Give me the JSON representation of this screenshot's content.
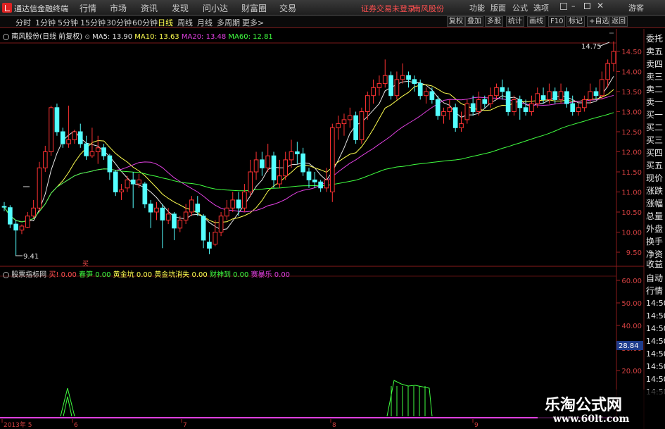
{
  "app": {
    "title": "通达信金融终端",
    "menus": [
      "行情",
      "市场",
      "资讯",
      "发现",
      "问小达",
      "财富圈",
      "交易"
    ],
    "status_notice": "证券交易未登录",
    "status_stock": "南风股份",
    "right_menus": [
      "功能",
      "版面",
      "公式",
      "选项"
    ],
    "guest": "游客"
  },
  "toolbar": {
    "periods": [
      "分时",
      "1分钟",
      "5分钟",
      "15分钟",
      "30分钟",
      "60分钟",
      "日线",
      "周线",
      "月线",
      "多周期",
      "更多>"
    ],
    "active_period": "日线",
    "right_buttons": [
      "复权",
      "叠加",
      "多股",
      "统计",
      "画线",
      "F10",
      "标记",
      "+自选",
      "返回"
    ]
  },
  "kline": {
    "title": "南风股份(日线 前复权)",
    "ma_labels": [
      {
        "text": "MA5: 13.90",
        "color": "#e6e6e6"
      },
      {
        "text": "MA10: 13.63",
        "color": "#ffff50"
      },
      {
        "text": "MA20: 13.48",
        "color": "#e040e0"
      },
      {
        "text": "MA60: 12.81",
        "color": "#40ff40"
      }
    ],
    "price_ticks": [
      "14.50",
      "14.00",
      "13.50",
      "13.00",
      "12.50",
      "12.00",
      "11.50",
      "11.00",
      "10.50",
      "10.00",
      "9.50"
    ],
    "high_label": "14.75",
    "low_label": "9.41",
    "up_color": "#ff3232",
    "down_color": "#54ffff"
  },
  "indicator": {
    "name": "股票指标网",
    "items": [
      {
        "label": "买!",
        "value": "0.00",
        "color": "#ff5050"
      },
      {
        "label": "春笋",
        "value": "0.00",
        "color": "#40ff40"
      },
      {
        "label": "黄金坑",
        "value": "0.00",
        "color": "#ffff50"
      },
      {
        "label": "黄金坑消失",
        "value": "0.00",
        "color": "#ffff50"
      },
      {
        "label": "财神到",
        "value": "0.00",
        "color": "#40ff40"
      },
      {
        "label": "赛暴乐",
        "value": "0.00",
        "color": "#e040e0"
      }
    ],
    "axis_ticks": [
      "60.00",
      "50.00",
      "40.00",
      "30.00",
      "20.00"
    ],
    "current_value": "28.84",
    "buy_marker": "买"
  },
  "time_axis": [
    "2013年 5",
    "6",
    "7",
    "8",
    "9"
  ],
  "right_panel": {
    "items": [
      "委托",
      "卖五",
      "卖四",
      "卖三",
      "卖二",
      "卖一",
      "买一",
      "买二",
      "买三",
      "买四",
      "买五",
      "现价",
      "涨跌",
      "涨幅",
      "总量",
      "外盘",
      "换手",
      "净资",
      "收益"
    ],
    "lower_items": [
      "自动",
      "行情"
    ],
    "times": [
      "14:50",
      "14:50",
      "14:50",
      "14:50",
      "14:50",
      "14:50",
      "14:50",
      "14:50"
    ]
  },
  "watermark": {
    "text": "乐淘公式网",
    "url": "www.60lt.com"
  },
  "chart_data": {
    "type": "candlestick",
    "y_range": [
      9.3,
      14.95
    ],
    "candles": [
      [
        10.64,
        10.62,
        10.75,
        10.52
      ],
      [
        10.61,
        10.2,
        10.67,
        10.1
      ],
      [
        10.2,
        10.05,
        10.3,
        9.41
      ],
      [
        10.05,
        10.15,
        10.19,
        9.95
      ],
      [
        10.12,
        10.4,
        10.5,
        10.1
      ],
      [
        10.4,
        10.6,
        10.8,
        10.35
      ],
      [
        10.6,
        11.6,
        11.75,
        10.5
      ],
      [
        11.6,
        12.0,
        12.15,
        11.5
      ],
      [
        12.0,
        13.1,
        13.15,
        11.9
      ],
      [
        13.1,
        12.5,
        13.2,
        12.4
      ],
      [
        12.5,
        12.2,
        12.6,
        12.1
      ],
      [
        12.2,
        12.3,
        13.15,
        12.1
      ],
      [
        12.3,
        12.5,
        12.55,
        12.2
      ],
      [
        12.5,
        12.2,
        12.7,
        12.1
      ],
      [
        12.2,
        11.9,
        12.4,
        11.8
      ],
      [
        11.9,
        12.0,
        12.6,
        11.85
      ],
      [
        12.0,
        12.1,
        12.4,
        11.7
      ],
      [
        12.1,
        11.9,
        12.2,
        11.8
      ],
      [
        11.9,
        11.5,
        11.95,
        11.3
      ],
      [
        11.5,
        11.0,
        11.55,
        10.9
      ],
      [
        11.0,
        11.05,
        11.2,
        10.8
      ],
      [
        11.1,
        11.3,
        11.4,
        11.0
      ],
      [
        11.3,
        11.2,
        11.5,
        10.6
      ],
      [
        11.2,
        11.3,
        11.45,
        11.1
      ],
      [
        11.2,
        10.7,
        11.25,
        10.6
      ],
      [
        10.7,
        10.5,
        10.8,
        10.1
      ],
      [
        10.5,
        10.6,
        10.75,
        10.3
      ],
      [
        10.6,
        10.3,
        10.7,
        9.6
      ],
      [
        10.3,
        10.45,
        10.6,
        10.2
      ],
      [
        10.45,
        10.1,
        10.5,
        9.8
      ],
      [
        10.1,
        10.3,
        10.4,
        10.0
      ],
      [
        10.3,
        10.5,
        10.7,
        10.2
      ],
      [
        10.5,
        10.8,
        10.9,
        10.4
      ],
      [
        10.7,
        10.5,
        10.9,
        10.4
      ],
      [
        10.4,
        9.8,
        10.45,
        9.6
      ],
      [
        9.75,
        9.6,
        10.0,
        9.45
      ],
      [
        9.7,
        10.0,
        10.3,
        9.65
      ],
      [
        10.0,
        10.4,
        10.5,
        9.9
      ],
      [
        10.4,
        10.6,
        10.8,
        10.3
      ],
      [
        10.6,
        10.8,
        11.0,
        10.5
      ],
      [
        10.8,
        10.6,
        11.0,
        10.4
      ],
      [
        10.6,
        11.0,
        11.2,
        10.5
      ],
      [
        11.0,
        11.5,
        11.8,
        10.9
      ],
      [
        11.5,
        11.8,
        12.0,
        11.3
      ],
      [
        11.8,
        11.6,
        12.0,
        11.4
      ],
      [
        11.6,
        11.9,
        12.2,
        11.5
      ],
      [
        11.9,
        11.3,
        12.0,
        11.1
      ],
      [
        11.2,
        11.4,
        11.8,
        11.1
      ],
      [
        11.4,
        11.8,
        12.0,
        11.3
      ],
      [
        11.8,
        12.0,
        12.3,
        11.6
      ],
      [
        12.0,
        11.95,
        12.25,
        11.7
      ],
      [
        11.95,
        11.5,
        12.1,
        11.4
      ],
      [
        11.5,
        11.3,
        11.6,
        11.1
      ],
      [
        11.3,
        11.25,
        11.5,
        11.1
      ],
      [
        11.25,
        11.1,
        11.3,
        11.0
      ],
      [
        11.1,
        11.3,
        11.6,
        11.0
      ],
      [
        11.0,
        12.6,
        12.7,
        10.75
      ],
      [
        12.6,
        12.7,
        12.9,
        12.3
      ],
      [
        12.7,
        12.8,
        12.95,
        12.4
      ],
      [
        12.8,
        12.9,
        13.1,
        12.6
      ],
      [
        12.9,
        12.3,
        13.0,
        12.2
      ],
      [
        12.3,
        13.0,
        13.1,
        12.2
      ],
      [
        13.0,
        13.4,
        13.5,
        12.8
      ],
      [
        13.4,
        13.6,
        13.8,
        13.2
      ],
      [
        13.6,
        13.7,
        13.9,
        13.4
      ],
      [
        13.7,
        13.9,
        14.3,
        13.6
      ],
      [
        13.9,
        13.4,
        14.0,
        13.3
      ],
      [
        13.4,
        13.8,
        14.0,
        13.3
      ],
      [
        13.8,
        13.9,
        14.2,
        13.7
      ],
      [
        13.9,
        13.8,
        14.0,
        13.6
      ],
      [
        13.8,
        13.7,
        13.9,
        13.5
      ],
      [
        13.7,
        13.4,
        13.8,
        13.3
      ],
      [
        13.4,
        13.5,
        13.6,
        13.2
      ],
      [
        13.5,
        13.3,
        13.6,
        13.2
      ],
      [
        13.3,
        12.9,
        13.4,
        12.8
      ],
      [
        12.9,
        13.0,
        13.1,
        12.7
      ],
      [
        13.0,
        13.1,
        13.3,
        12.8
      ],
      [
        13.1,
        12.6,
        13.2,
        12.5
      ],
      [
        12.6,
        12.7,
        13.0,
        12.5
      ],
      [
        12.8,
        13.2,
        13.3,
        12.7
      ],
      [
        13.2,
        13.0,
        13.4,
        12.9
      ],
      [
        13.0,
        13.3,
        13.5,
        12.9
      ],
      [
        13.3,
        13.2,
        13.4,
        13.1
      ],
      [
        13.2,
        13.4,
        13.6,
        13.1
      ],
      [
        13.4,
        13.6,
        13.7,
        13.3
      ],
      [
        13.6,
        13.5,
        13.8,
        13.3
      ],
      [
        13.5,
        13.0,
        13.6,
        12.9
      ],
      [
        13.0,
        13.3,
        13.4,
        12.9
      ],
      [
        13.3,
        13.1,
        13.4,
        12.8
      ],
      [
        13.1,
        13.0,
        13.3,
        12.9
      ],
      [
        13.0,
        13.2,
        13.4,
        12.9
      ],
      [
        13.2,
        13.45,
        13.6,
        13.1
      ],
      [
        13.4,
        13.3,
        13.6,
        13.2
      ],
      [
        13.3,
        13.5,
        13.7,
        13.2
      ],
      [
        13.5,
        13.3,
        13.6,
        13.2
      ],
      [
        13.3,
        13.5,
        13.7,
        13.2
      ],
      [
        13.5,
        13.2,
        13.6,
        13.1
      ],
      [
        13.2,
        13.0,
        13.4,
        12.9
      ],
      [
        13.0,
        13.1,
        13.2,
        12.9
      ],
      [
        13.1,
        13.3,
        13.4,
        13.0
      ],
      [
        13.3,
        13.5,
        13.7,
        13.2
      ],
      [
        13.5,
        13.4,
        13.6,
        13.3
      ],
      [
        13.4,
        13.8,
        14.0,
        13.3
      ],
      [
        13.8,
        14.2,
        14.3,
        13.6
      ],
      [
        14.2,
        14.5,
        14.75,
        14.0
      ]
    ],
    "ma_series": [
      {
        "name": "MA5",
        "color": "#e6e6e6",
        "y0": 10.5,
        "y1": 13.9
      },
      {
        "name": "MA10",
        "color": "#ffff50",
        "y0": 10.6,
        "y1": 13.63
      },
      {
        "name": "MA20",
        "color": "#e040e0",
        "y0": 10.8,
        "y1": 13.48
      },
      {
        "name": "MA60",
        "color": "#40ff40",
        "y0": 10.9,
        "y1": 12.81
      }
    ]
  }
}
